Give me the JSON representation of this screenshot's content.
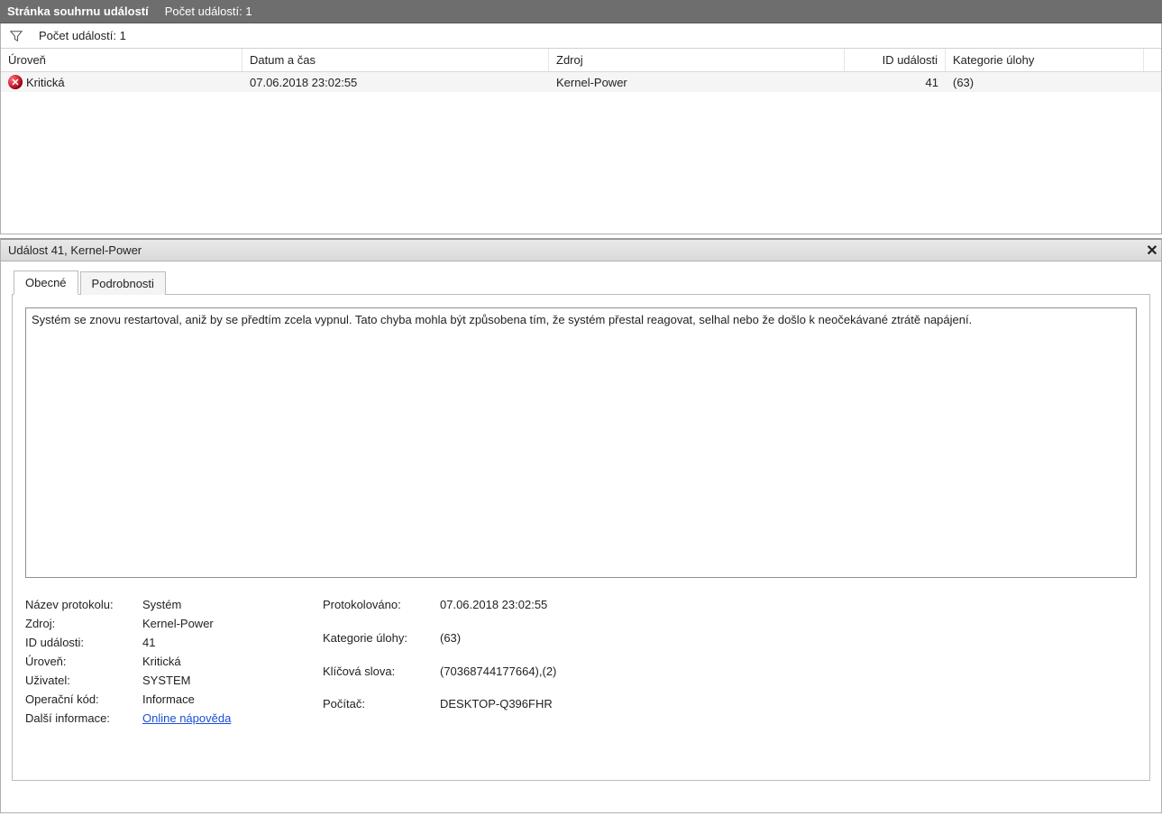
{
  "titlebar": {
    "title": "Stránka souhrnu událostí",
    "count_label": "Počet událostí: 1"
  },
  "filter_row": {
    "count_label": "Počet událostí: 1"
  },
  "columns": {
    "level": "Úroveň",
    "datetime": "Datum a čas",
    "source": "Zdroj",
    "event_id": "ID události",
    "task_category": "Kategorie úlohy"
  },
  "rows": [
    {
      "level": "Kritická",
      "datetime": "07.06.2018 23:02:55",
      "source": "Kernel-Power",
      "event_id": "41",
      "task_category": "(63)"
    }
  ],
  "detail": {
    "header": "Událost 41, Kernel-Power",
    "tabs": {
      "general": "Obecné",
      "details": "Podrobnosti"
    },
    "description": "Systém se znovu restartoval, aniž by se předtím zcela vypnul. Tato chyba mohla být způsobena tím, že systém přestal reagovat, selhal nebo že došlo k neočekávané ztrátě napájení.",
    "labels": {
      "log_name": "Název protokolu:",
      "source": "Zdroj:",
      "event_id": "ID události:",
      "level": "Úroveň:",
      "user": "Uživatel:",
      "opcode": "Operační kód:",
      "more_info": "Další informace:",
      "logged": "Protokolováno:",
      "task_category": "Kategorie úlohy:",
      "keywords": "Klíčová slova:",
      "computer": "Počítač:"
    },
    "values": {
      "log_name": "Systém",
      "source": "Kernel-Power",
      "event_id": "41",
      "level": "Kritická",
      "user": "SYSTEM",
      "opcode": "Informace",
      "more_info_link": "Online nápověda",
      "logged": "07.06.2018 23:02:55",
      "task_category": "(63)",
      "keywords": "(70368744177664),(2)",
      "computer": "DESKTOP-Q396FHR"
    }
  }
}
